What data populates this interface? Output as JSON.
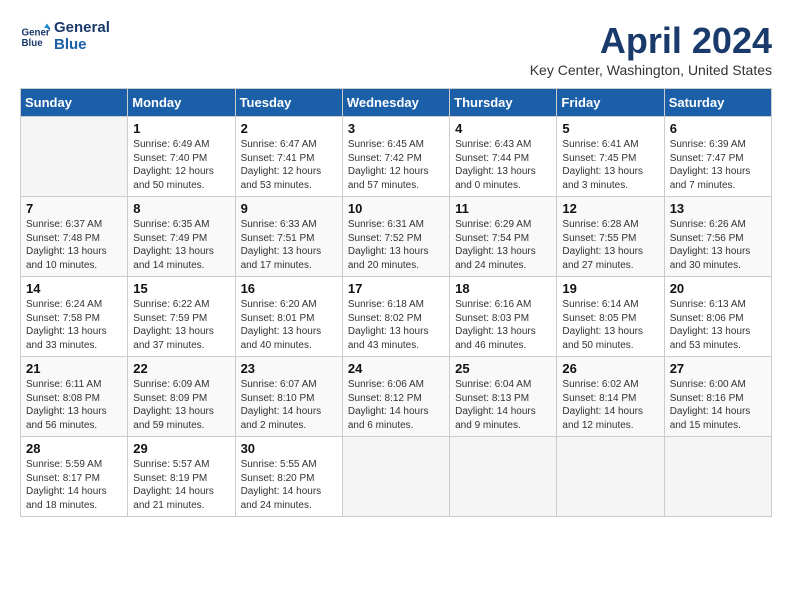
{
  "header": {
    "logo_line1": "General",
    "logo_line2": "Blue",
    "title": "April 2024",
    "location": "Key Center, Washington, United States"
  },
  "columns": [
    "Sunday",
    "Monday",
    "Tuesday",
    "Wednesday",
    "Thursday",
    "Friday",
    "Saturday"
  ],
  "weeks": [
    [
      {
        "day": "",
        "empty": true
      },
      {
        "day": "1",
        "sunrise": "Sunrise: 6:49 AM",
        "sunset": "Sunset: 7:40 PM",
        "daylight": "Daylight: 12 hours and 50 minutes."
      },
      {
        "day": "2",
        "sunrise": "Sunrise: 6:47 AM",
        "sunset": "Sunset: 7:41 PM",
        "daylight": "Daylight: 12 hours and 53 minutes."
      },
      {
        "day": "3",
        "sunrise": "Sunrise: 6:45 AM",
        "sunset": "Sunset: 7:42 PM",
        "daylight": "Daylight: 12 hours and 57 minutes."
      },
      {
        "day": "4",
        "sunrise": "Sunrise: 6:43 AM",
        "sunset": "Sunset: 7:44 PM",
        "daylight": "Daylight: 13 hours and 0 minutes."
      },
      {
        "day": "5",
        "sunrise": "Sunrise: 6:41 AM",
        "sunset": "Sunset: 7:45 PM",
        "daylight": "Daylight: 13 hours and 3 minutes."
      },
      {
        "day": "6",
        "sunrise": "Sunrise: 6:39 AM",
        "sunset": "Sunset: 7:47 PM",
        "daylight": "Daylight: 13 hours and 7 minutes."
      }
    ],
    [
      {
        "day": "7",
        "sunrise": "Sunrise: 6:37 AM",
        "sunset": "Sunset: 7:48 PM",
        "daylight": "Daylight: 13 hours and 10 minutes."
      },
      {
        "day": "8",
        "sunrise": "Sunrise: 6:35 AM",
        "sunset": "Sunset: 7:49 PM",
        "daylight": "Daylight: 13 hours and 14 minutes."
      },
      {
        "day": "9",
        "sunrise": "Sunrise: 6:33 AM",
        "sunset": "Sunset: 7:51 PM",
        "daylight": "Daylight: 13 hours and 17 minutes."
      },
      {
        "day": "10",
        "sunrise": "Sunrise: 6:31 AM",
        "sunset": "Sunset: 7:52 PM",
        "daylight": "Daylight: 13 hours and 20 minutes."
      },
      {
        "day": "11",
        "sunrise": "Sunrise: 6:29 AM",
        "sunset": "Sunset: 7:54 PM",
        "daylight": "Daylight: 13 hours and 24 minutes."
      },
      {
        "day": "12",
        "sunrise": "Sunrise: 6:28 AM",
        "sunset": "Sunset: 7:55 PM",
        "daylight": "Daylight: 13 hours and 27 minutes."
      },
      {
        "day": "13",
        "sunrise": "Sunrise: 6:26 AM",
        "sunset": "Sunset: 7:56 PM",
        "daylight": "Daylight: 13 hours and 30 minutes."
      }
    ],
    [
      {
        "day": "14",
        "sunrise": "Sunrise: 6:24 AM",
        "sunset": "Sunset: 7:58 PM",
        "daylight": "Daylight: 13 hours and 33 minutes."
      },
      {
        "day": "15",
        "sunrise": "Sunrise: 6:22 AM",
        "sunset": "Sunset: 7:59 PM",
        "daylight": "Daylight: 13 hours and 37 minutes."
      },
      {
        "day": "16",
        "sunrise": "Sunrise: 6:20 AM",
        "sunset": "Sunset: 8:01 PM",
        "daylight": "Daylight: 13 hours and 40 minutes."
      },
      {
        "day": "17",
        "sunrise": "Sunrise: 6:18 AM",
        "sunset": "Sunset: 8:02 PM",
        "daylight": "Daylight: 13 hours and 43 minutes."
      },
      {
        "day": "18",
        "sunrise": "Sunrise: 6:16 AM",
        "sunset": "Sunset: 8:03 PM",
        "daylight": "Daylight: 13 hours and 46 minutes."
      },
      {
        "day": "19",
        "sunrise": "Sunrise: 6:14 AM",
        "sunset": "Sunset: 8:05 PM",
        "daylight": "Daylight: 13 hours and 50 minutes."
      },
      {
        "day": "20",
        "sunrise": "Sunrise: 6:13 AM",
        "sunset": "Sunset: 8:06 PM",
        "daylight": "Daylight: 13 hours and 53 minutes."
      }
    ],
    [
      {
        "day": "21",
        "sunrise": "Sunrise: 6:11 AM",
        "sunset": "Sunset: 8:08 PM",
        "daylight": "Daylight: 13 hours and 56 minutes."
      },
      {
        "day": "22",
        "sunrise": "Sunrise: 6:09 AM",
        "sunset": "Sunset: 8:09 PM",
        "daylight": "Daylight: 13 hours and 59 minutes."
      },
      {
        "day": "23",
        "sunrise": "Sunrise: 6:07 AM",
        "sunset": "Sunset: 8:10 PM",
        "daylight": "Daylight: 14 hours and 2 minutes."
      },
      {
        "day": "24",
        "sunrise": "Sunrise: 6:06 AM",
        "sunset": "Sunset: 8:12 PM",
        "daylight": "Daylight: 14 hours and 6 minutes."
      },
      {
        "day": "25",
        "sunrise": "Sunrise: 6:04 AM",
        "sunset": "Sunset: 8:13 PM",
        "daylight": "Daylight: 14 hours and 9 minutes."
      },
      {
        "day": "26",
        "sunrise": "Sunrise: 6:02 AM",
        "sunset": "Sunset: 8:14 PM",
        "daylight": "Daylight: 14 hours and 12 minutes."
      },
      {
        "day": "27",
        "sunrise": "Sunrise: 6:00 AM",
        "sunset": "Sunset: 8:16 PM",
        "daylight": "Daylight: 14 hours and 15 minutes."
      }
    ],
    [
      {
        "day": "28",
        "sunrise": "Sunrise: 5:59 AM",
        "sunset": "Sunset: 8:17 PM",
        "daylight": "Daylight: 14 hours and 18 minutes."
      },
      {
        "day": "29",
        "sunrise": "Sunrise: 5:57 AM",
        "sunset": "Sunset: 8:19 PM",
        "daylight": "Daylight: 14 hours and 21 minutes."
      },
      {
        "day": "30",
        "sunrise": "Sunrise: 5:55 AM",
        "sunset": "Sunset: 8:20 PM",
        "daylight": "Daylight: 14 hours and 24 minutes."
      },
      {
        "day": "",
        "empty": true
      },
      {
        "day": "",
        "empty": true
      },
      {
        "day": "",
        "empty": true
      },
      {
        "day": "",
        "empty": true
      }
    ]
  ]
}
